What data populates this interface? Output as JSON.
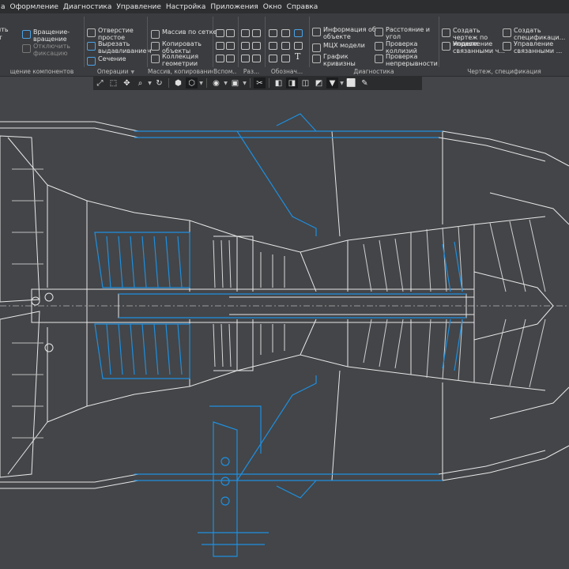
{
  "menu": [
    "а",
    "Оформление",
    "Диагностика",
    "Управление",
    "Настройка",
    "Приложения",
    "Окно",
    "Справка"
  ],
  "ribbon": {
    "components": {
      "rotate_label": "Вращение-вращение",
      "disable_fix_label": "Отключить фиксацию",
      "partial1": "ить",
      "partial2": "т",
      "group_label": "щение компонентов"
    },
    "operations": {
      "hole_label": "Отверстие простое",
      "cut_extrude_label": "Вырезать выдавливанием",
      "section_label": "Сечение",
      "group_label": "Операции"
    },
    "arrays": {
      "grid_array_label": "Массив по сетке",
      "copy_objects_label": "Копировать объекты",
      "geometry_collection_label": "Коллекция геометрии",
      "group_label": "Массив, копирование"
    },
    "aux": {
      "group_label": "Вспом..."
    },
    "small1": {
      "group_label": "Раз..."
    },
    "designations": {
      "group_label": "Обознач..."
    },
    "diagnostics": {
      "object_info_label": "Информация об объекте",
      "mass_props_label": "МЦХ модели",
      "curvature_graph_label": "График кривизны",
      "distance_angle_label": "Расстояние и угол",
      "collision_check_label": "Проверка коллизий",
      "continuity_check_label": "Проверка непрерывности",
      "group_label": "Диагностика"
    },
    "drawing_spec": {
      "create_drawing_label": "Создать чертеж по модели",
      "create_spec_label": "Создать спецификаци...",
      "manage_linked1_label": "Управление связанными ч...",
      "manage_linked2_label": "Управление связанными ...",
      "group_label": "Чертеж, спецификация"
    }
  },
  "colors": {
    "accent_blue": "#1e8fe0",
    "line_white": "#e8e8e8",
    "background": "#434548",
    "ribbon": "#3b3c3f",
    "menubar": "#2d2e30"
  },
  "icons": [
    "zoom-icon",
    "zoom-select-icon",
    "rotate-icon",
    "cube-icon",
    "view-orientation-icon",
    "eye-icon",
    "display-mode-icon",
    "section-view-icon",
    "filter-icon",
    "brush-icon"
  ]
}
